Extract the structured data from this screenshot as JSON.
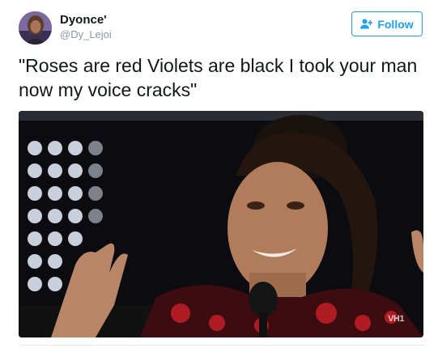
{
  "user": {
    "display_name": "Dyonce'",
    "handle": "@Dy_Lejoi"
  },
  "follow_button": {
    "label": "Follow",
    "icon": "add-person-icon"
  },
  "tweet": {
    "text": "\"Roses are red Violets are black I took your man now my voice cracks\""
  },
  "media": {
    "watermark": "VH1"
  },
  "colors": {
    "accent": "#1da1f2",
    "text": "#14171a",
    "secondary_text": "#8899a6"
  }
}
